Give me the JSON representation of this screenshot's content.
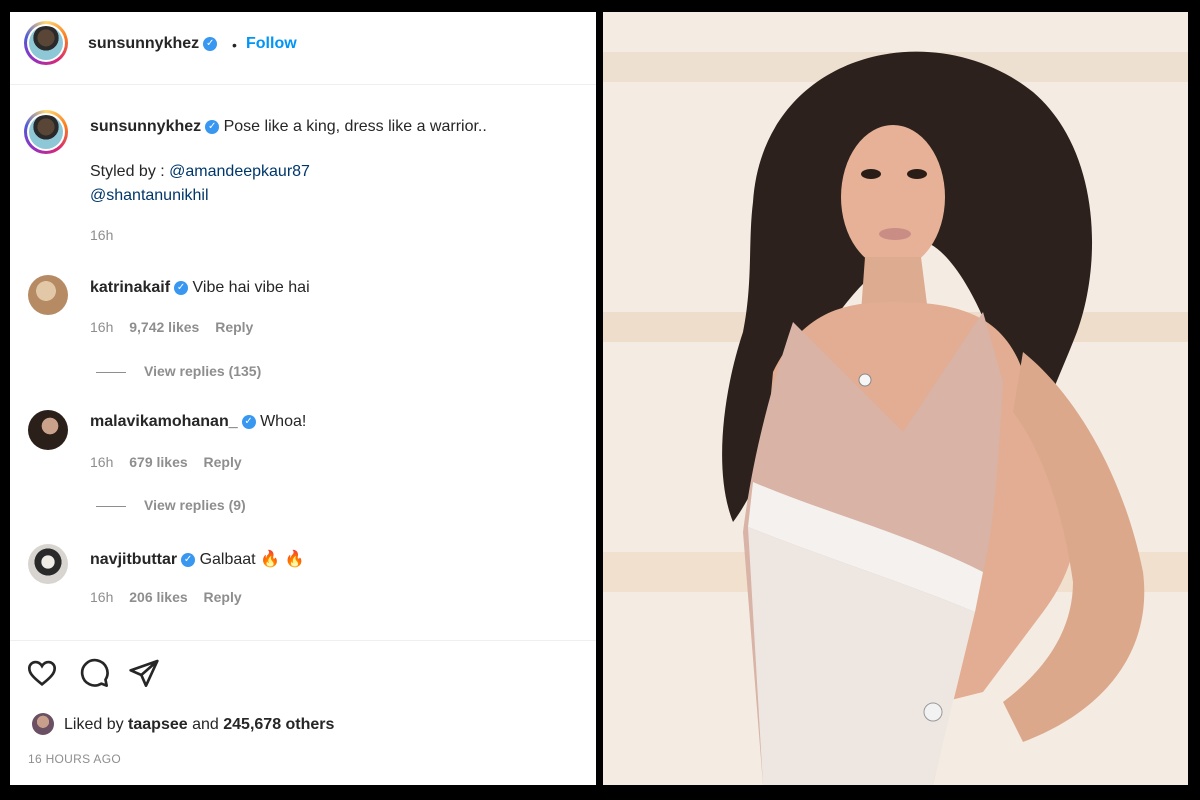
{
  "post": {
    "author": "sunsunnykhez",
    "separator": "•",
    "follow_label": "Follow",
    "caption_text": "Pose like a king, dress like a warrior..",
    "styled_by_label": "Styled by :",
    "mention_1": "@amandeepkaur87",
    "mention_2": "@shantanunikhil",
    "caption_time": "16h"
  },
  "comments": [
    {
      "user": "katrinakaif",
      "text": "Vibe hai vibe hai",
      "time": "16h",
      "likes": "9,742 likes",
      "reply": "Reply",
      "view_replies": "View replies (135)",
      "avatar_color": "#c9a27d"
    },
    {
      "user": "malavikamohanan_",
      "text": "Whoa!",
      "time": "16h",
      "likes": "679 likes",
      "reply": "Reply",
      "view_replies": "View replies (9)",
      "avatar_color": "#3a2a24"
    },
    {
      "user": "navjitbuttar",
      "text": "Galbaat",
      "emoji": "🔥 🔥",
      "time": "16h",
      "likes": "206 likes",
      "reply": "Reply",
      "avatar_color": "#d9d6d2"
    }
  ],
  "footer": {
    "liked_prefix": "Liked by",
    "liked_user": "taapsee",
    "liked_and": "and",
    "liked_count": "245,678 others",
    "time_ago": "16 HOURS AGO"
  },
  "icons": {
    "like": "heart-icon",
    "comment": "comment-icon",
    "share": "send-icon",
    "verified": "verified-badge-icon"
  },
  "colors": {
    "link": "#0095f6",
    "mention": "#00376b",
    "verified": "#3897f0",
    "muted": "#8e8e8e"
  }
}
